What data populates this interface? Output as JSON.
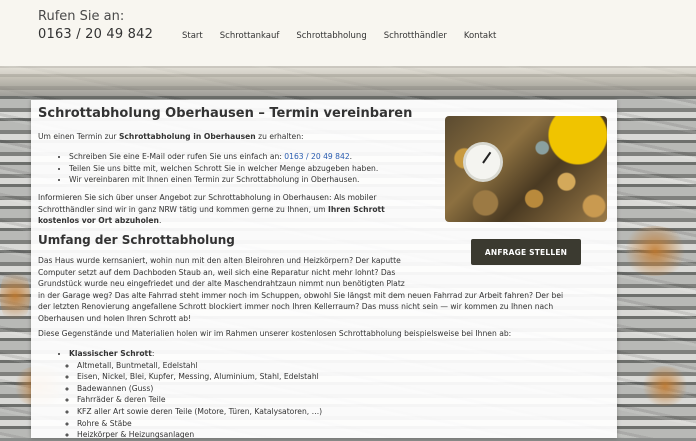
{
  "header": {
    "phone_label": "Rufen Sie an:",
    "phone_number": "0163 / 20 49 842"
  },
  "nav": {
    "items": [
      "Start",
      "Schrottankauf",
      "Schrottabholung",
      "Schrotthändler",
      "Kontakt"
    ]
  },
  "main": {
    "title": "Schrottabholung Oberhausen – Termin vereinbaren",
    "intro": {
      "prefix": "Um einen Termin zur ",
      "bold": "Schrottabholung in Oberhausen",
      "suffix": " zu erhalten:"
    },
    "steps": {
      "step1_prefix": "Schreiben Sie eine E-Mail oder rufen Sie uns einfach an: ",
      "step1_link": "0163 / 20 49 842",
      "step1_suffix": ".",
      "step2": "Teilen Sie uns bitte mit, welchen Schrott Sie in welcher Menge abzugeben haben.",
      "step3": "Wir vereinbaren mit Ihnen einen Termin zur Schrottabholung in Oberhausen."
    },
    "info": {
      "line1": "Informieren Sie sich über unser Angebot zur Schrottabholung in Oberhausen: Als mobiler",
      "line2_prefix": "Schrotthändler sind wir in ganz NRW tätig und kommen gerne zu Ihnen, um ",
      "line2_bold": "Ihren Schrott",
      "line3_bold": "kostenlos vor Ort abzuholen",
      "line3_suffix": "."
    },
    "subtitle": "Umfang der Schrottabholung",
    "paragraph": {
      "line1": "Das Haus wurde kernsaniert, wohin nun mit den alten Bleirohren und Heizkörpern? Der kaputte",
      "line2": "Computer setzt auf dem Dachboden Staub an, weil sich eine Reparatur nicht mehr lohnt? Das",
      "line3": "Grundstück wurde neu eingefriedet und der alte Maschendrahtzaun nimmt nun benötigten Platz",
      "line4": "in der Garage weg? Das alte Fahrrad steht immer noch im Schuppen, obwohl Sie längst mit dem neuen Fahrrad zur Arbeit fahren? Der bei",
      "line5": "der letzten Renovierung angefallene Schrott blockiert immer noch Ihren Kellerraum? Das muss nicht sein — wir kommen zu Ihnen nach",
      "line6": "Oberhausen und holen Ihren Schrott ab!"
    },
    "materials_intro": "Diese Gegenstände und Materialien holen wir im Rahmen unserer kostenlosen Schrottabholung beispielsweise bei Ihnen ab:",
    "category": "Klassischer Schrott",
    "category_suffix": ":",
    "materials": [
      "Altmetall, Buntmetall, Edelstahl",
      "Eisen, Nickel, Blei, Kupfer, Messing, Aluminium, Stahl, Edelstahl",
      "Badewannen (Guss)",
      "Fahrräder & deren Teile",
      "KFZ aller Art sowie deren Teile (Motore, Türen, Katalysatoren, …)",
      "Rohre & Stäbe",
      "Heizkörper & Heizungsanlagen"
    ],
    "cta_label": "ANFRAGE STELLEN"
  },
  "colors": {
    "header_bg": "#f8f6f0",
    "cta_bg": "#3b3a30",
    "link": "#2a5db0"
  }
}
